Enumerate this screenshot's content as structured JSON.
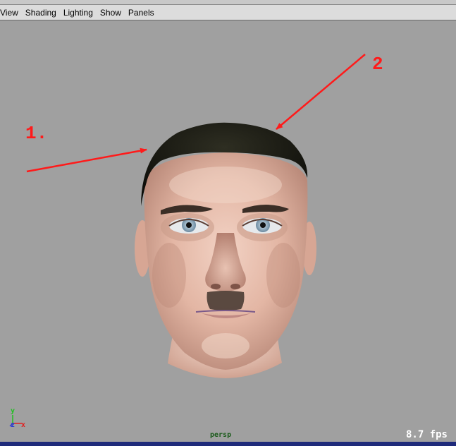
{
  "menubar": {
    "items": [
      {
        "label": "View"
      },
      {
        "label": "Shading"
      },
      {
        "label": "Lighting"
      },
      {
        "label": "Show"
      },
      {
        "label": "Panels"
      }
    ]
  },
  "viewport": {
    "camera": "persp",
    "fps": "8.7 fps",
    "annotations": [
      {
        "label": "1."
      },
      {
        "label": "2"
      }
    ],
    "axis": {
      "y": "y",
      "z": "z",
      "x": "x"
    }
  },
  "colors": {
    "viewport_bg": "#a0a0a0",
    "annotation_red": "#ff1a1a",
    "axis_y": "#20c020",
    "axis_z": "#2a3ad0",
    "axis_x": "#e02020"
  },
  "icons": [
    "axis-gizmo-icon"
  ]
}
